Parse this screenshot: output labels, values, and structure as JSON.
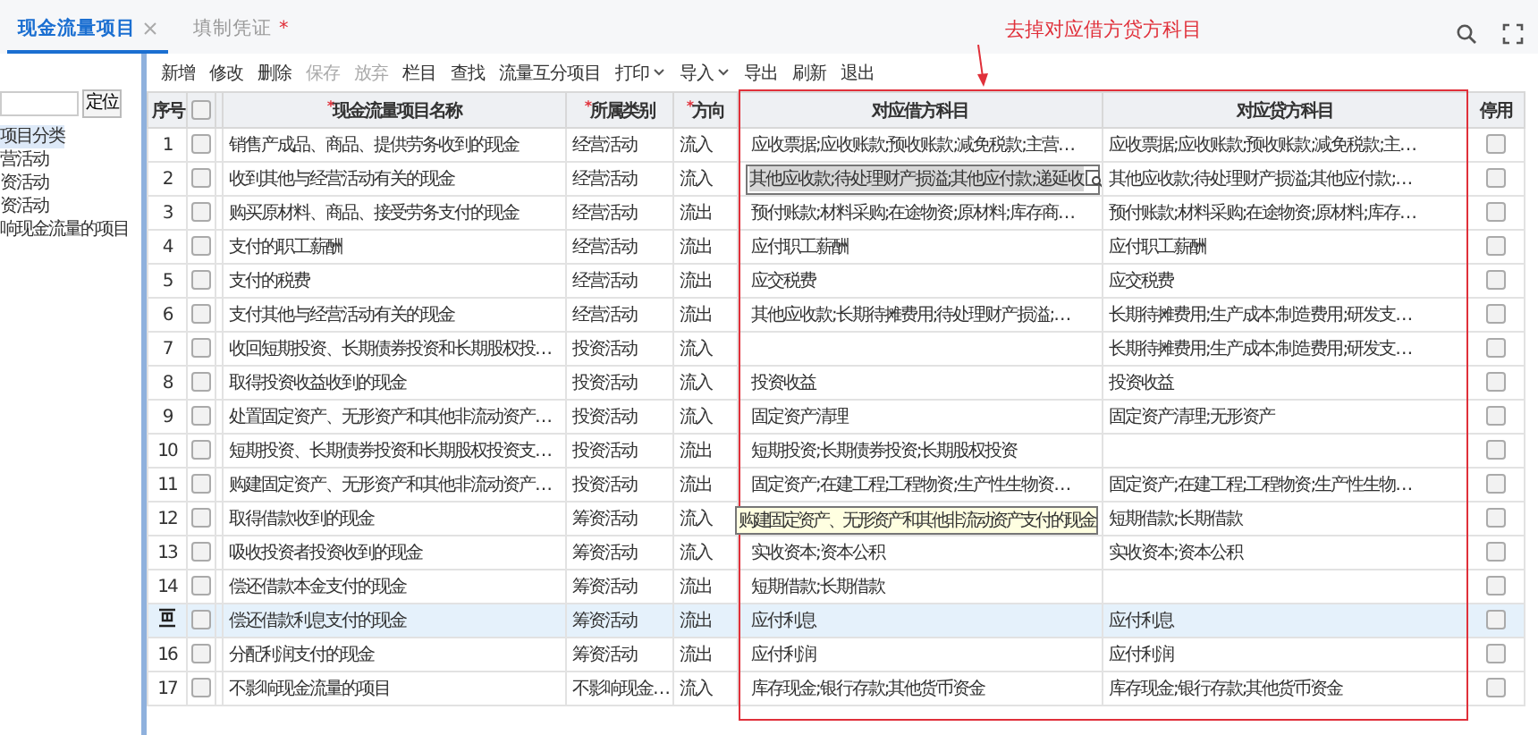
{
  "tabs": [
    {
      "label": "现金流量项目",
      "selected": true,
      "closable": true
    },
    {
      "label": "填制凭证",
      "selected": false,
      "closable": false,
      "marker": "*"
    }
  ],
  "annotation": {
    "text": "去掉对应借方贷方科目"
  },
  "sidebar": {
    "locate_button": "定位",
    "items": [
      {
        "label": "项目分类",
        "selected": true
      },
      {
        "label": "营活动",
        "selected": false
      },
      {
        "label": "资活动",
        "selected": false
      },
      {
        "label": "资活动",
        "selected": false
      },
      {
        "label": "响现金流量的项目",
        "selected": false
      }
    ]
  },
  "toolbar": [
    {
      "label": "新增",
      "disabled": false,
      "dropdown": false
    },
    {
      "label": "修改",
      "disabled": false,
      "dropdown": false
    },
    {
      "label": "删除",
      "disabled": false,
      "dropdown": false
    },
    {
      "label": "保存",
      "disabled": true,
      "dropdown": false
    },
    {
      "label": "放弃",
      "disabled": true,
      "dropdown": false
    },
    {
      "label": "栏目",
      "disabled": false,
      "dropdown": false
    },
    {
      "label": "查找",
      "disabled": false,
      "dropdown": false
    },
    {
      "label": "流量互分项目",
      "disabled": false,
      "dropdown": false
    },
    {
      "label": "打印",
      "disabled": false,
      "dropdown": true
    },
    {
      "label": "导入",
      "disabled": false,
      "dropdown": true
    },
    {
      "label": "导出",
      "disabled": false,
      "dropdown": false
    },
    {
      "label": "刷新",
      "disabled": false,
      "dropdown": false
    },
    {
      "label": "退出",
      "disabled": false,
      "dropdown": false
    }
  ],
  "table": {
    "select_all_checked": false,
    "columns": [
      {
        "label": "序号",
        "kind": "seq"
      },
      {
        "kind": "check"
      },
      {
        "kind": "narrow"
      },
      {
        "label": "现金流量项目名称",
        "marker": "*",
        "kind": "name"
      },
      {
        "label": "所属类别",
        "marker": "*",
        "kind": "category"
      },
      {
        "label": "方向",
        "marker": "*",
        "kind": "direction"
      },
      {
        "label": "对应借方科目",
        "kind": "debit"
      },
      {
        "label": "对应贷方科目",
        "kind": "credit"
      },
      {
        "label": "停用",
        "kind": "stop"
      }
    ],
    "rows": [
      {
        "seq": "1",
        "selected": false,
        "checked": false,
        "name": "销售产成品、商品、提供劳务收到的现金",
        "category": "经营活动",
        "direction": "流入",
        "debit": "应收票据;应收账款;预收账款;减免税款;主营…",
        "credit": "应收票据;应收账款;预收账款;减免税款;主…",
        "stopped": false
      },
      {
        "seq": "2",
        "selected": false,
        "checked": false,
        "name": "收到其他与经营活动有关的现金",
        "category": "经营活动",
        "direction": "流入",
        "debit": "其他应收款;待处理财产损溢;其他应付款;递延收",
        "debit_editing": true,
        "credit": "其他应收款;待处理财产损溢;其他应付款;…",
        "stopped": false
      },
      {
        "seq": "3",
        "selected": false,
        "checked": false,
        "name": "购买原材料、商品、接受劳务支付的现金",
        "category": "经营活动",
        "direction": "流出",
        "debit": "预付账款;材料采购;在途物资;原材料;库存商…",
        "credit": "预付账款;材料采购;在途物资;原材料;库存…",
        "stopped": false
      },
      {
        "seq": "4",
        "selected": false,
        "checked": false,
        "name": "支付的职工薪酬",
        "category": "经营活动",
        "direction": "流出",
        "debit": "应付职工薪酬",
        "credit": "应付职工薪酬",
        "stopped": false
      },
      {
        "seq": "5",
        "selected": false,
        "checked": false,
        "name": "支付的税费",
        "category": "经营活动",
        "direction": "流出",
        "debit": "应交税费",
        "credit": "应交税费",
        "stopped": false
      },
      {
        "seq": "6",
        "selected": false,
        "checked": false,
        "name": "支付其他与经营活动有关的现金",
        "category": "经营活动",
        "direction": "流出",
        "debit": "其他应收款;长期待摊费用;待处理财产损溢;…",
        "credit": "长期待摊费用;生产成本;制造费用;研发支…",
        "stopped": false
      },
      {
        "seq": "7",
        "selected": false,
        "checked": false,
        "name": "收回短期投资、长期债券投资和长期股权投…",
        "category": "投资活动",
        "direction": "流入",
        "credit": "长期待摊费用;生产成本;制造费用;研发支…",
        "stopped": false
      },
      {
        "seq": "8",
        "selected": false,
        "checked": false,
        "name": "取得投资收益收到的现金",
        "category": "投资活动",
        "direction": "流入",
        "debit": "投资收益",
        "credit": "投资收益",
        "stopped": false
      },
      {
        "seq": "9",
        "selected": false,
        "checked": false,
        "name": "处置固定资产、无形资产和其他非流动资产…",
        "category": "投资活动",
        "direction": "流入",
        "debit": "固定资产清理",
        "credit": "固定资产清理;无形资产",
        "stopped": false
      },
      {
        "seq": "10",
        "selected": false,
        "checked": false,
        "name": "短期投资、长期债券投资和长期股权投资支…",
        "category": "投资活动",
        "direction": "流出",
        "debit": "短期投资;长期债券投资;长期股权投资",
        "stopped": false
      },
      {
        "seq": "11",
        "selected": false,
        "checked": false,
        "name": "购建固定资产、无形资产和其他非流动资产…",
        "category": "投资活动",
        "direction": "流出",
        "debit": "固定资产;在建工程;工程物资;生产性生物资…",
        "credit": "固定资产;在建工程;工程物资;生产性生物…",
        "stopped": false,
        "tooltip": "购建固定资产、无形资产和其他非流动资产支付的现金"
      },
      {
        "seq": "12",
        "selected": false,
        "checked": false,
        "name": "取得借款收到的现金",
        "category": "筹资活动",
        "direction": "流入",
        "credit": "短期借款;长期借款",
        "stopped": false
      },
      {
        "seq": "13",
        "selected": false,
        "checked": false,
        "name": "吸收投资者投资收到的现金",
        "category": "筹资活动",
        "direction": "流入",
        "debit": "实收资本;资本公积",
        "credit": "实收资本;资本公积",
        "stopped": false
      },
      {
        "seq": "14",
        "selected": false,
        "checked": false,
        "name": "偿还借款本金支付的现金",
        "category": "筹资活动",
        "direction": "流出",
        "debit": "短期借款;长期借款",
        "stopped": false
      },
      {
        "selected": true,
        "checked": false,
        "name": "偿还借款利息支付的现金",
        "category": "筹资活动",
        "direction": "流出",
        "debit": "应付利息",
        "credit": "应付利息",
        "stopped": false
      },
      {
        "seq": "16",
        "selected": false,
        "checked": false,
        "name": "分配利润支付的现金",
        "category": "筹资活动",
        "direction": "流出",
        "debit": "应付利润",
        "credit": "应付利润",
        "stopped": false
      },
      {
        "seq": "17",
        "selected": false,
        "checked": false,
        "name": "不影响现金流量的项目",
        "category": "不影响现金…",
        "direction": "流入",
        "debit": "库存现金;银行存款;其他货币资金",
        "credit": "库存现金;银行存款;其他货币资金",
        "stopped": false
      }
    ]
  }
}
